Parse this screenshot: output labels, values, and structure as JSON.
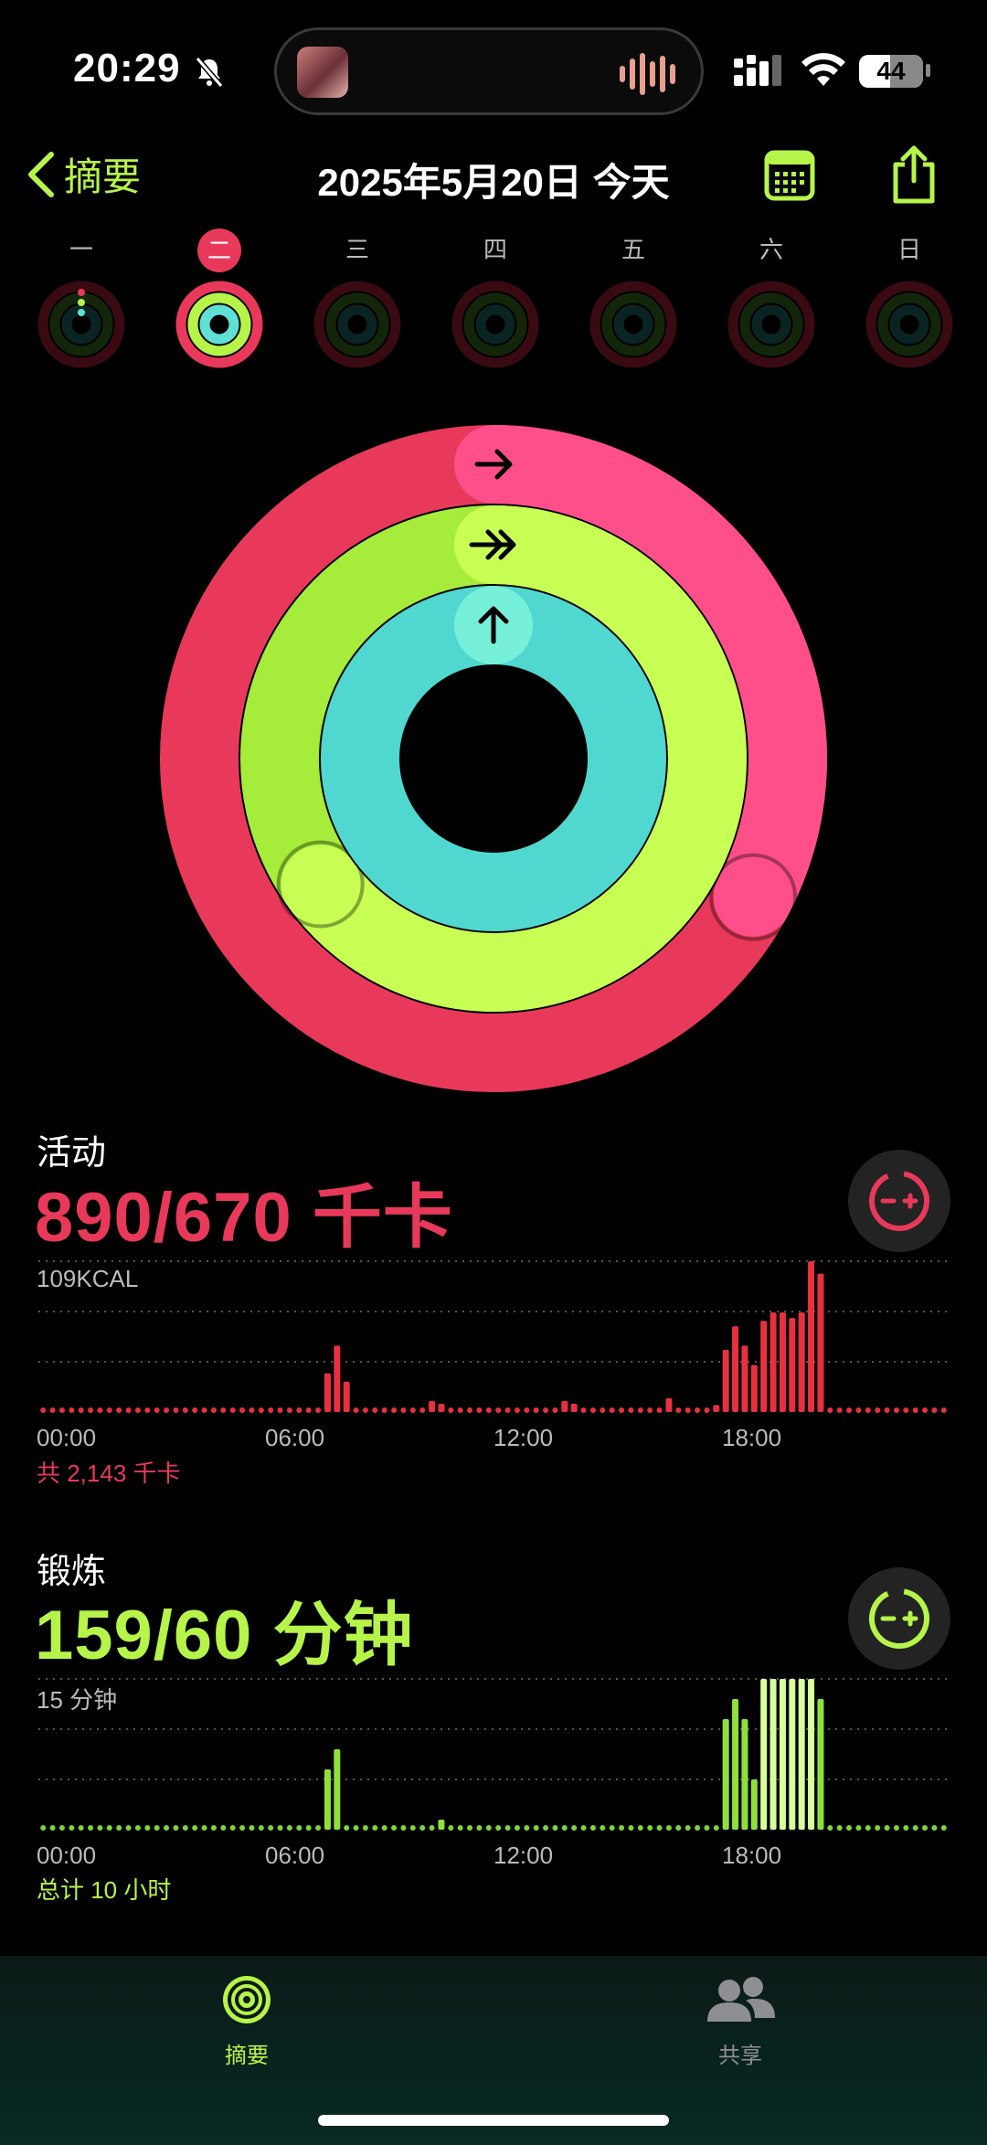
{
  "status_bar": {
    "time": "20:29",
    "battery": "44"
  },
  "nav": {
    "back_label": "摘要",
    "title": "2025年5月20日 今天"
  },
  "week": {
    "days": [
      "一",
      "二",
      "三",
      "四",
      "五",
      "六",
      "日"
    ],
    "selected_index": 1
  },
  "colors": {
    "move": "#e8395a",
    "exercise": "#b6f44a",
    "stand": "#5fe0d4",
    "accent": "#b6f44a"
  },
  "rings": {
    "move_progress": 1.328,
    "exercise_progress": 2.65,
    "stand_progress": 1.0
  },
  "activity": {
    "title": "活动",
    "value": "890/670 千卡",
    "chart_top_label": "109KCAL",
    "x_ticks": [
      "00:00",
      "06:00",
      "12:00",
      "18:00"
    ],
    "total": "共 2,143 千卡"
  },
  "exercise": {
    "title": "锻炼",
    "value": "159/60 分钟",
    "chart_top_label": "15 分钟",
    "x_ticks": [
      "00:00",
      "06:00",
      "12:00",
      "18:00"
    ],
    "total": "总计 10 小时"
  },
  "chart_data": [
    {
      "type": "bar",
      "title": "活动",
      "ylabel": "KCAL",
      "ymax": 109,
      "x_range": [
        "00:00",
        "24:00"
      ],
      "interval_minutes": 15,
      "nonzero_bars": [
        {
          "time": "07:30",
          "value": 28
        },
        {
          "time": "07:45",
          "value": 48
        },
        {
          "time": "08:00",
          "value": 22
        },
        {
          "time": "10:15",
          "value": 8
        },
        {
          "time": "10:30",
          "value": 6
        },
        {
          "time": "13:45",
          "value": 8
        },
        {
          "time": "14:00",
          "value": 6
        },
        {
          "time": "16:30",
          "value": 10
        },
        {
          "time": "17:45",
          "value": 5
        },
        {
          "time": "18:00",
          "value": 45
        },
        {
          "time": "18:15",
          "value": 62
        },
        {
          "time": "18:30",
          "value": 48
        },
        {
          "time": "18:45",
          "value": 34
        },
        {
          "time": "19:00",
          "value": 66
        },
        {
          "time": "19:15",
          "value": 72
        },
        {
          "time": "19:30",
          "value": 72
        },
        {
          "time": "19:45",
          "value": 68
        },
        {
          "time": "20:00",
          "value": 72
        },
        {
          "time": "20:15",
          "value": 109
        },
        {
          "time": "20:30",
          "value": 100
        }
      ]
    },
    {
      "type": "bar",
      "title": "锻炼",
      "ylabel": "分钟",
      "ymax": 15,
      "x_range": [
        "00:00",
        "24:00"
      ],
      "interval_minutes": 15,
      "nonzero_bars": [
        {
          "time": "07:30",
          "value": 6
        },
        {
          "time": "07:45",
          "value": 8
        },
        {
          "time": "10:30",
          "value": 1
        },
        {
          "time": "18:00",
          "value": 11
        },
        {
          "time": "18:15",
          "value": 13
        },
        {
          "time": "18:30",
          "value": 11
        },
        {
          "time": "18:45",
          "value": 5
        },
        {
          "time": "19:00",
          "value": 15
        },
        {
          "time": "19:15",
          "value": 15
        },
        {
          "time": "19:30",
          "value": 15
        },
        {
          "time": "19:45",
          "value": 15
        },
        {
          "time": "20:00",
          "value": 15
        },
        {
          "time": "20:15",
          "value": 15
        },
        {
          "time": "20:30",
          "value": 13
        }
      ]
    }
  ],
  "tabs": [
    {
      "label": "摘要",
      "icon": "activity-rings-icon",
      "active": true
    },
    {
      "label": "共享",
      "icon": "people-icon",
      "active": false
    }
  ]
}
